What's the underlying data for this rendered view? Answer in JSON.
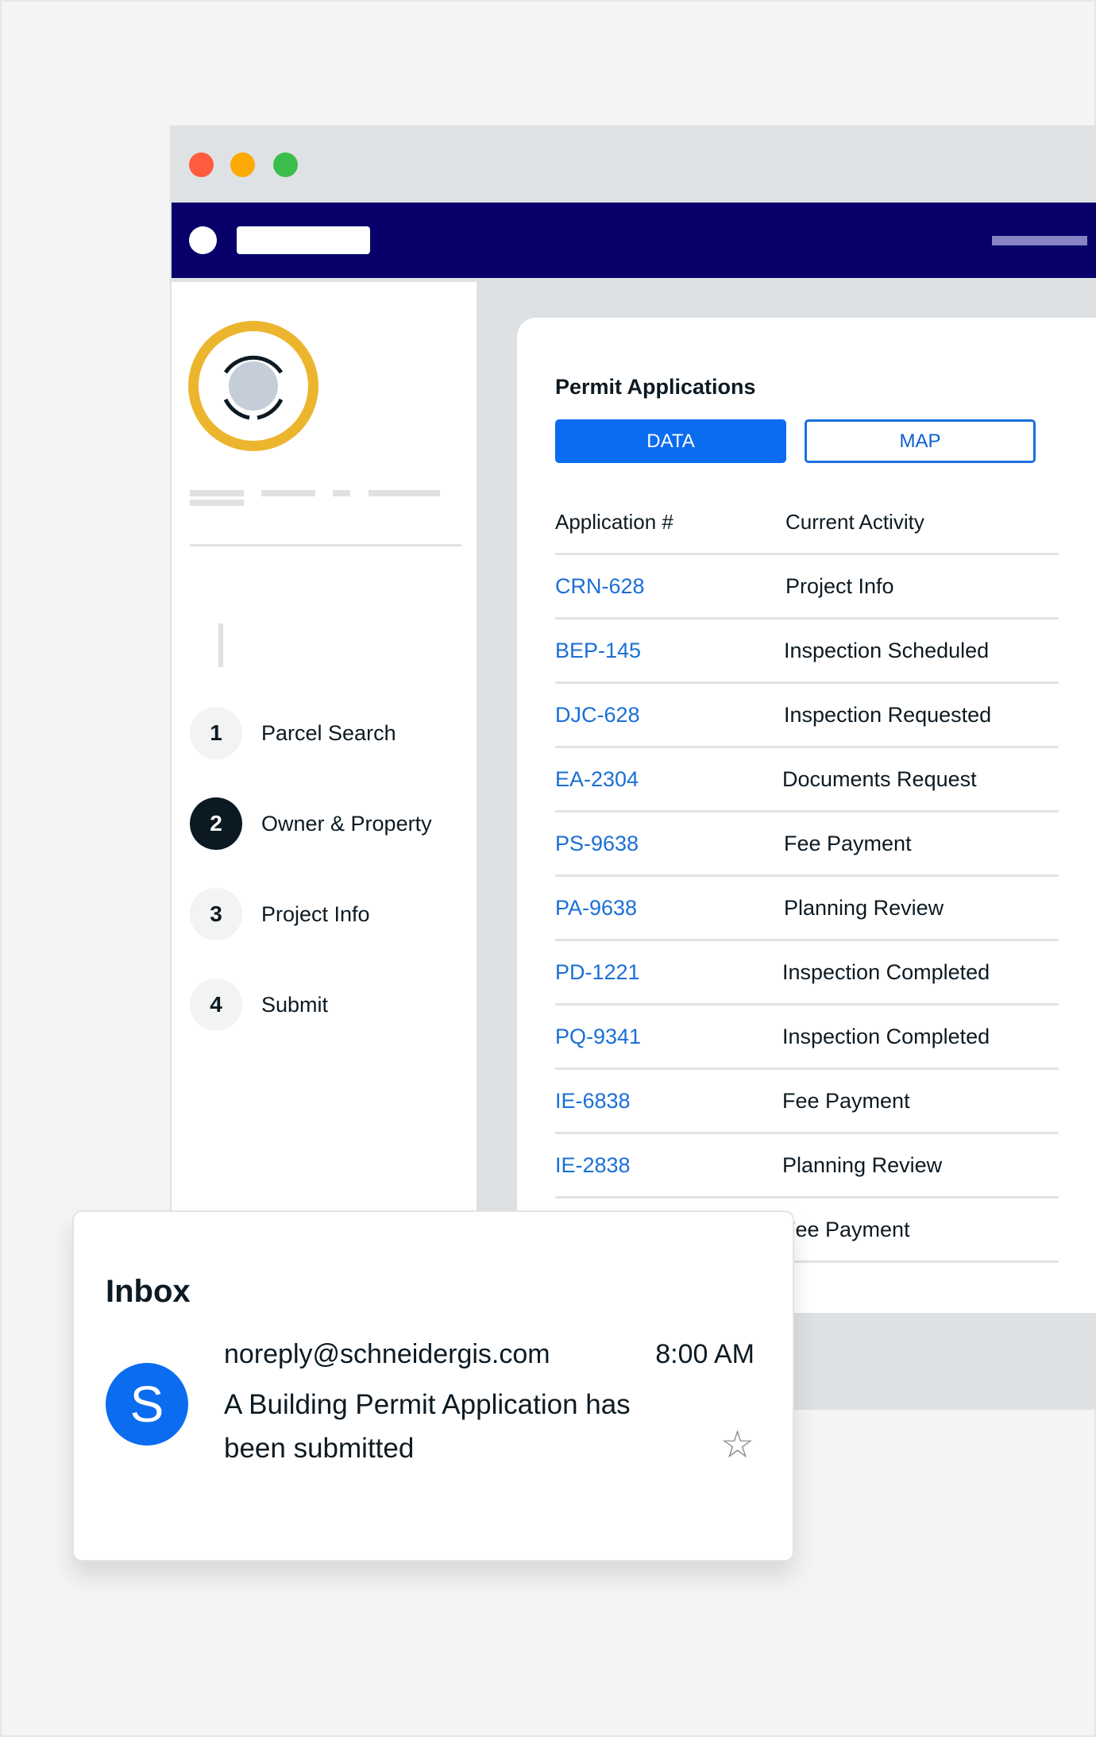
{
  "window": {
    "controls": [
      "close",
      "minimize",
      "maximize"
    ],
    "colors": {
      "close": "#ff5b3f",
      "minimize": "#fdaa07",
      "maximize": "#3bbd4b",
      "navbar": "#07006a"
    }
  },
  "sidebar": {
    "avatar_icon": "user-placeholder-icon",
    "steps": [
      {
        "number": "1",
        "label": "Parcel Search",
        "active": false
      },
      {
        "number": "2",
        "label": "Owner & Property",
        "active": true
      },
      {
        "number": "3",
        "label": "Project Info",
        "active": false
      },
      {
        "number": "4",
        "label": "Submit",
        "active": false
      }
    ]
  },
  "main": {
    "title": "Permit Applications",
    "tabs": [
      {
        "label": "DATA",
        "selected": true
      },
      {
        "label": "MAP",
        "selected": false
      }
    ],
    "table": {
      "headers": [
        "Application #",
        "Current Activity"
      ],
      "rows": [
        [
          "CRN-628",
          "Project Info"
        ],
        [
          "BEP-145",
          "Inspection Scheduled"
        ],
        [
          "DJC-628",
          "Inspection Requested"
        ],
        [
          "EA-2304",
          "Documents Request"
        ],
        [
          "PS-9638",
          "Fee Payment"
        ],
        [
          "PA-9638",
          "Planning Review"
        ],
        [
          "PD-1221",
          "Inspection Completed"
        ],
        [
          "PQ-9341",
          "Inspection Completed"
        ],
        [
          "IE-6838",
          "Fee Payment"
        ],
        [
          "IE-2838",
          "Planning Review"
        ],
        [
          "",
          "Fee Payment"
        ]
      ]
    },
    "accent": "#0b6cf0",
    "link_color": "#1a6fd6"
  },
  "inbox": {
    "title": "Inbox",
    "message": {
      "avatar_letter": "S",
      "from": "noreply@schneidergis.com",
      "time": "8:00 AM",
      "subject": "A Building Permit Application has been submitted",
      "starred": false
    }
  }
}
